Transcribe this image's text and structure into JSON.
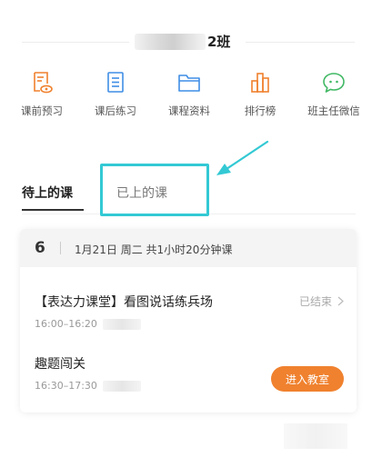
{
  "header": {
    "class_name": "2班",
    "class_name_blurred": true
  },
  "nav": {
    "items": [
      {
        "label": "课前预习",
        "icon": "preview-book-icon",
        "color": "#f0812e"
      },
      {
        "label": "课后练习",
        "icon": "exercise-list-icon",
        "color": "#3f8ee6"
      },
      {
        "label": "课程资料",
        "icon": "folder-icon",
        "color": "#3f8ee6"
      },
      {
        "label": "排行榜",
        "icon": "ranking-bars-icon",
        "color": "#f0812e"
      },
      {
        "label": "班主任微信",
        "icon": "wechat-icon",
        "color": "#41b864"
      }
    ]
  },
  "tabs": [
    {
      "label": "待上的课",
      "active": true
    },
    {
      "label": "已上的课",
      "active": false
    }
  ],
  "annotation": {
    "highlight_color": "#33c9d4",
    "highlighted_tab": "已上的课"
  },
  "card": {
    "day": "6",
    "summary": "1月21日 周二 共1小时20分钟课",
    "lessons": [
      {
        "title": "【表达力课堂】看图说话练兵场",
        "time": "16:00–16:20",
        "status": "已结束"
      },
      {
        "title": "趣题闯关",
        "time": "16:30–17:30",
        "action": "进入教室",
        "action_color": "#f0812e"
      }
    ]
  }
}
